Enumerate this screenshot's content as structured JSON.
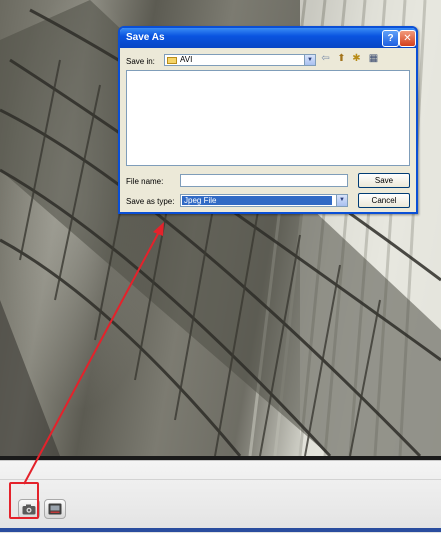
{
  "dialog": {
    "title": "Save As",
    "help_glyph": "?",
    "close_glyph": "✕",
    "save_in_label": "Save in:",
    "save_in_value": "AVI",
    "file_name_label": "File name:",
    "file_name_value": "",
    "save_as_type_label": "Save as type:",
    "save_as_type_value": "Jpeg File",
    "save_button": "Save",
    "cancel_button": "Cancel",
    "dropdown_glyph": "▼",
    "nav_icons": {
      "back": "⇦",
      "up": "⬆",
      "new_folder": "✱",
      "views": "▦"
    }
  },
  "toolbar": {
    "snapshot_icon": "camera-icon",
    "record_icon": "video-icon"
  },
  "colors": {
    "annotation_red": "#e4222b",
    "titlebar_blue": "#0a54e0",
    "selection_blue": "#316ac5"
  }
}
